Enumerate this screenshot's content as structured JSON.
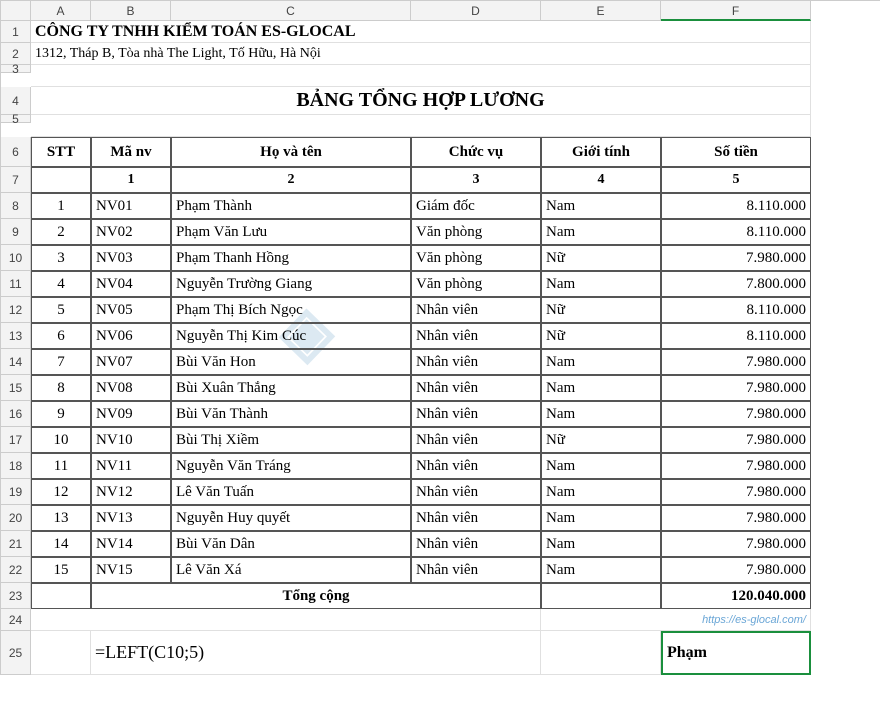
{
  "col_headers": [
    "A",
    "B",
    "C",
    "D",
    "E",
    "F"
  ],
  "row_headers": [
    "1",
    "2",
    "3",
    "4",
    "5",
    "6",
    "7",
    "8",
    "9",
    "10",
    "11",
    "12",
    "13",
    "14",
    "15",
    "16",
    "17",
    "18",
    "19",
    "20",
    "21",
    "22",
    "23",
    "24",
    "25"
  ],
  "company": "CÔNG TY TNHH KIỂM TOÁN ES-GLOCAL",
  "address": "1312, Tháp B, Tòa nhà The Light, Tố Hữu, Hà Nội",
  "title": "BẢNG TỔNG HỢP LƯƠNG",
  "headers": {
    "stt": "STT",
    "manv": "Mã nv",
    "hovaten": "Họ và tên",
    "chucvu": "Chức vụ",
    "gioitinh": "Giới tính",
    "sotien": "Số tiền"
  },
  "headnums": {
    "b": "1",
    "c": "2",
    "d": "3",
    "e": "4",
    "f": "5"
  },
  "rows": [
    {
      "stt": "1",
      "manv": "NV01",
      "ten": "Phạm Thành",
      "cv": "Giám đốc",
      "gt": "Nam",
      "tien": "8.110.000"
    },
    {
      "stt": "2",
      "manv": "NV02",
      "ten": "Phạm Văn Lưu",
      "cv": "Văn phòng",
      "gt": "Nam",
      "tien": "8.110.000"
    },
    {
      "stt": "3",
      "manv": "NV03",
      "ten": "Phạm Thanh Hồng",
      "cv": "Văn phòng",
      "gt": "Nữ",
      "tien": "7.980.000"
    },
    {
      "stt": "4",
      "manv": "NV04",
      "ten": "Nguyễn Trường Giang",
      "cv": "Văn phòng",
      "gt": "Nam",
      "tien": "7.800.000"
    },
    {
      "stt": "5",
      "manv": "NV05",
      "ten": "Phạm Thị Bích Ngọc",
      "cv": "Nhân viên",
      "gt": "Nữ",
      "tien": "8.110.000"
    },
    {
      "stt": "6",
      "manv": "NV06",
      "ten": "Nguyễn Thị Kim Cúc",
      "cv": "Nhân viên",
      "gt": "Nữ",
      "tien": "8.110.000"
    },
    {
      "stt": "7",
      "manv": "NV07",
      "ten": "Bùi Văn Hon",
      "cv": "Nhân viên",
      "gt": "Nam",
      "tien": "7.980.000"
    },
    {
      "stt": "8",
      "manv": "NV08",
      "ten": "Bùi Xuân Thắng",
      "cv": "Nhân viên",
      "gt": "Nam",
      "tien": "7.980.000"
    },
    {
      "stt": "9",
      "manv": "NV09",
      "ten": "Bùi Văn Thành",
      "cv": "Nhân viên",
      "gt": "Nam",
      "tien": "7.980.000"
    },
    {
      "stt": "10",
      "manv": "NV10",
      "ten": "Bùi Thị Xiềm",
      "cv": "Nhân viên",
      "gt": "Nữ",
      "tien": "7.980.000"
    },
    {
      "stt": "11",
      "manv": "NV11",
      "ten": "Nguyễn Văn Tráng",
      "cv": "Nhân viên",
      "gt": "Nam",
      "tien": "7.980.000"
    },
    {
      "stt": "12",
      "manv": "NV12",
      "ten": "Lê Văn Tuấn",
      "cv": "Nhân viên",
      "gt": "Nam",
      "tien": "7.980.000"
    },
    {
      "stt": "13",
      "manv": "NV13",
      "ten": "Nguyễn Huy quyết",
      "cv": "Nhân viên",
      "gt": "Nam",
      "tien": "7.980.000"
    },
    {
      "stt": "14",
      "manv": "NV14",
      "ten": "Bùi Văn Dân",
      "cv": "Nhân viên",
      "gt": "Nam",
      "tien": "7.980.000"
    },
    {
      "stt": "15",
      "manv": "NV15",
      "ten": "Lê Văn Xá",
      "cv": "Nhân viên",
      "gt": "Nam",
      "tien": "7.980.000"
    }
  ],
  "total": {
    "label": "Tổng cộng",
    "value": "120.040.000"
  },
  "url_note": "https://es-glocal.com/",
  "formula": "=LEFT(C10;5)",
  "result": "Phạm",
  "chart_data": {
    "type": "table",
    "title": "BẢNG TỔNG HỢP LƯƠNG",
    "columns": [
      "STT",
      "Mã nv",
      "Họ và tên",
      "Chức vụ",
      "Giới tính",
      "Số tiền"
    ],
    "rows": [
      [
        1,
        "NV01",
        "Phạm Thành",
        "Giám đốc",
        "Nam",
        8110000
      ],
      [
        2,
        "NV02",
        "Phạm Văn Lưu",
        "Văn phòng",
        "Nam",
        8110000
      ],
      [
        3,
        "NV03",
        "Phạm Thanh Hồng",
        "Văn phòng",
        "Nữ",
        7980000
      ],
      [
        4,
        "NV04",
        "Nguyễn Trường Giang",
        "Văn phòng",
        "Nam",
        7800000
      ],
      [
        5,
        "NV05",
        "Phạm Thị Bích Ngọc",
        "Nhân viên",
        "Nữ",
        8110000
      ],
      [
        6,
        "NV06",
        "Nguyễn Thị Kim Cúc",
        "Nhân viên",
        "Nữ",
        8110000
      ],
      [
        7,
        "NV07",
        "Bùi Văn Hon",
        "Nhân viên",
        "Nam",
        7980000
      ],
      [
        8,
        "NV08",
        "Bùi Xuân Thắng",
        "Nhân viên",
        "Nam",
        7980000
      ],
      [
        9,
        "NV09",
        "Bùi Văn Thành",
        "Nhân viên",
        "Nam",
        7980000
      ],
      [
        10,
        "NV10",
        "Bùi Thị Xiềm",
        "Nhân viên",
        "Nữ",
        7980000
      ],
      [
        11,
        "NV11",
        "Nguyễn Văn Tráng",
        "Nhân viên",
        "Nam",
        7980000
      ],
      [
        12,
        "NV12",
        "Lê Văn Tuấn",
        "Nhân viên",
        "Nam",
        7980000
      ],
      [
        13,
        "NV13",
        "Nguyễn Huy quyết",
        "Nhân viên",
        "Nam",
        7980000
      ],
      [
        14,
        "NV14",
        "Bùi Văn Dân",
        "Nhân viên",
        "Nam",
        7980000
      ],
      [
        15,
        "NV15",
        "Lê Văn Xá",
        "Nhân viên",
        "Nam",
        7980000
      ]
    ],
    "total": 120040000
  }
}
